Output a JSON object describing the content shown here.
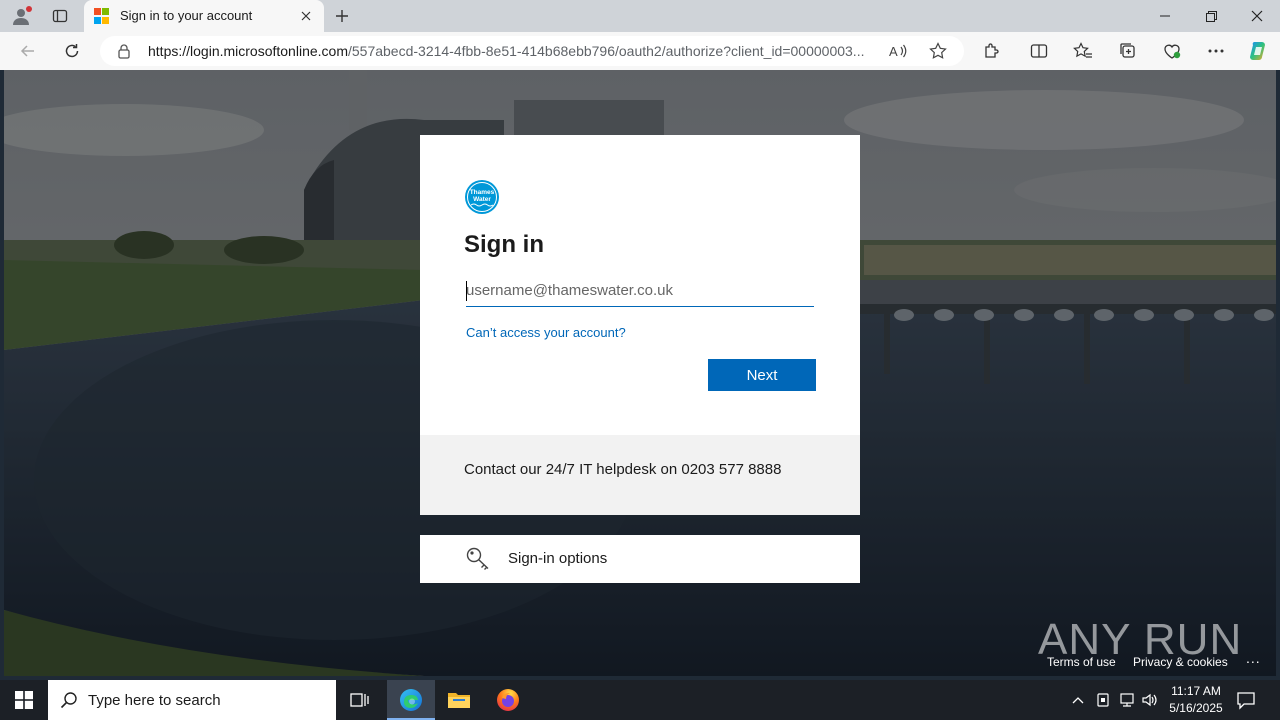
{
  "browser": {
    "tab_title": "Sign in to your account",
    "url_domain": "https://login.microsoftonline.com",
    "url_path": "/557abecd-3214-4fbb-8e51-414b68ebb796/oauth2/authorize?client_id=00000003...",
    "icons": [
      "profile-icon",
      "tab-actions-icon",
      "close-tab-icon",
      "new-tab-icon",
      "back-icon",
      "refresh-icon",
      "lock-icon",
      "read-aloud-icon",
      "favorite-star-icon",
      "extensions-icon",
      "split-screen-icon",
      "favorites-icon",
      "collections-icon",
      "browser-essentials-icon",
      "more-icon",
      "copilot-icon",
      "minimize-icon",
      "restore-icon",
      "close-window-icon"
    ]
  },
  "signin": {
    "logo_text": "Thames Water",
    "title": "Sign in",
    "email_placeholder": "username@thameswater.co.uk",
    "email_value": "",
    "cant_access": "Can’t access your account?",
    "next_label": "Next",
    "helpdesk": "Contact our 24/7 IT helpdesk on 0203 577 8888",
    "options_label": "Sign-in options"
  },
  "footer": {
    "terms": "Terms of use",
    "privacy": "Privacy & cookies",
    "more": "...",
    "watermark": "ANY RUN"
  },
  "taskbar": {
    "search_placeholder": "Type here to search",
    "time": "11:17 AM",
    "date": "5/16/2025",
    "apps": [
      "task-view-icon",
      "edge-icon",
      "file-explorer-icon",
      "firefox-icon"
    ]
  },
  "colors": {
    "accent": "#0067b8",
    "taskbar": "#1c2026",
    "footer_band": "#f2f2f2"
  }
}
